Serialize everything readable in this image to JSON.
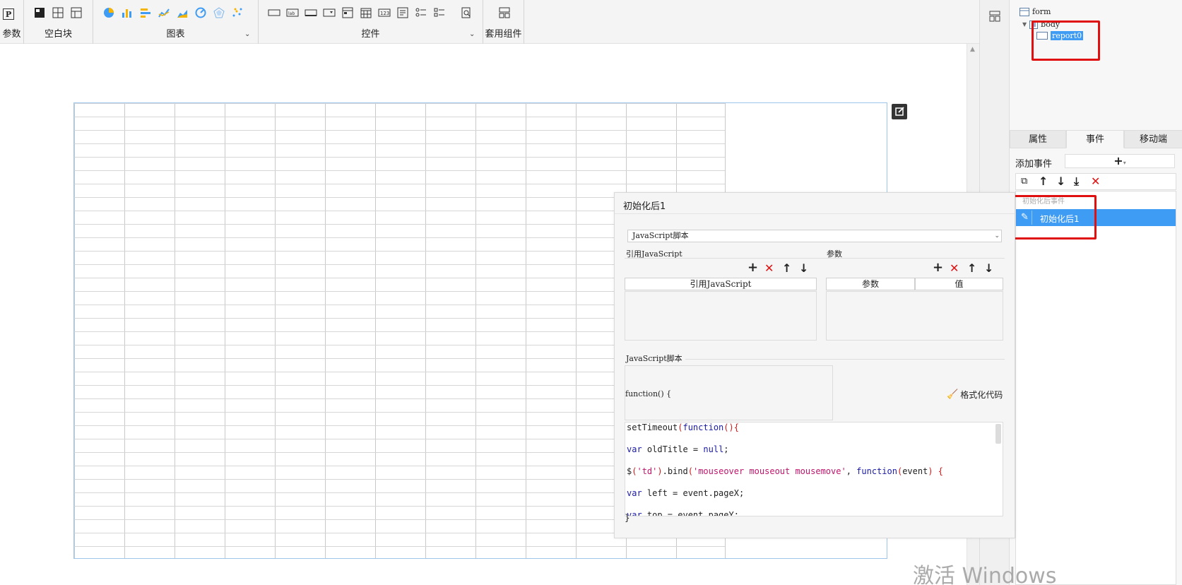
{
  "toolbar": {
    "groups": [
      {
        "label": "参数"
      },
      {
        "label": "空白块"
      },
      {
        "label": "图表"
      },
      {
        "label": "控件"
      },
      {
        "label": "套用组件"
      }
    ],
    "param_icon": "P"
  },
  "tree": {
    "form": "form",
    "body": "body",
    "report": "report0"
  },
  "tabs": [
    "属性",
    "事件",
    "移动端"
  ],
  "events": {
    "add_label": "添加事件",
    "add_symbol": "+",
    "category": "初始化后事件",
    "item": "初始化后1"
  },
  "dialog": {
    "title": "初始化后1",
    "script_type": "JavaScript脚本",
    "ref_js_label": "引用JavaScript",
    "params_label": "参数",
    "ref_js_header": "引用JavaScript",
    "param_header": "参数",
    "value_header": "值",
    "script_label": "JavaScript脚本",
    "function_open": "function() {",
    "format_code": "格式化代码",
    "function_close": "}",
    "code_lines": [
      "setTimeout(function(){",
      "var oldTitle = null;",
      "$('td').bind('mouseover mouseout mousemove', function(event) {",
      "var left = event.pageX;",
      "var top = event.pageY;"
    ]
  },
  "watermark": "激活 Windows",
  "colors": {
    "accent": "#3e9cf5",
    "highlight": "#e01010"
  }
}
